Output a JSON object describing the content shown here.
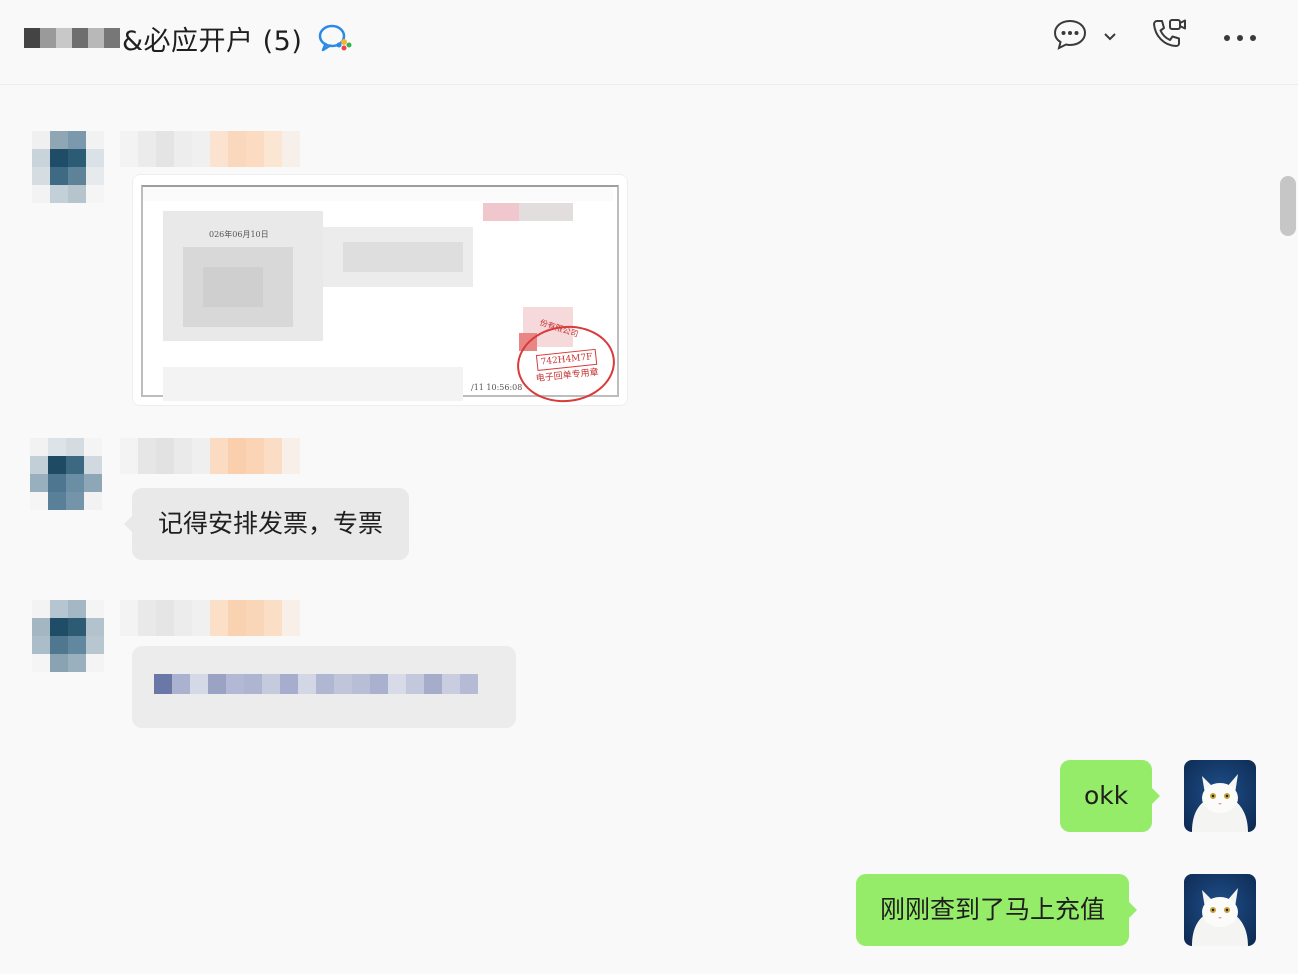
{
  "header": {
    "title": "&必应开户 (5)",
    "icons": {
      "group_chat": "group-chat-icon",
      "chat_menu": "chat-bubble-icon",
      "dropdown": "chevron-down-icon",
      "call": "phone-video-icon",
      "more": "more-horizontal-icon"
    }
  },
  "messages": {
    "invoice_stamp_code": "742H4M7F",
    "invoice_stamp_label": "电子回单专用章",
    "invoice_date_text": "026年06月10日",
    "invoice_company_text": "份有限公司",
    "invoice_footer_text": "/11 10:56:08",
    "remind_invoice": "记得安排发票，专票",
    "reply_okk": "okk",
    "reply_recharge": "刚刚查到了马上充值"
  },
  "colors": {
    "outgoing_bubble": "#95ec69",
    "incoming_bubble": "#e9e9e9",
    "stamp_red": "#d93a3a",
    "background": "#f9f9f9"
  }
}
